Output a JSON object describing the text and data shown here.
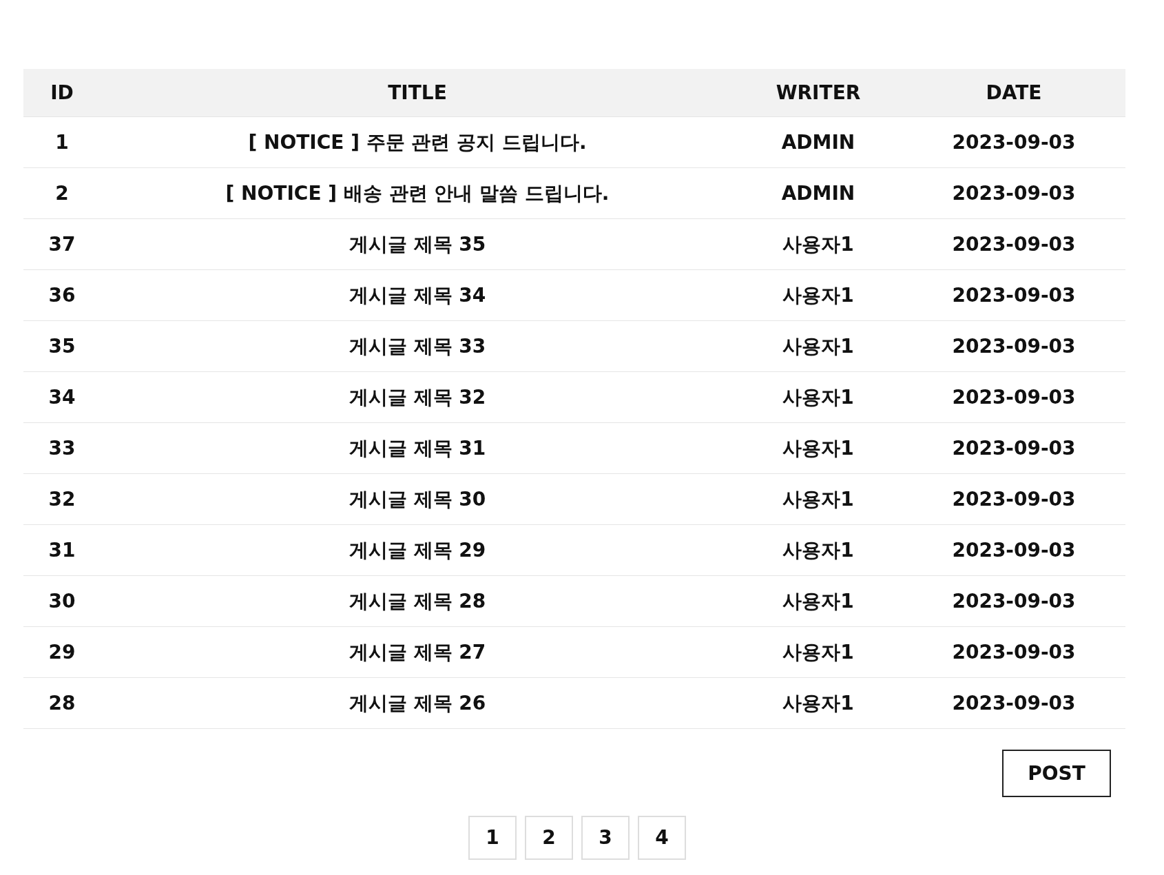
{
  "table": {
    "columns": [
      "ID",
      "TITLE",
      "WRITER",
      "DATE"
    ],
    "rows": [
      {
        "id": "1",
        "title": "[ NOTICE ] 주문 관련 공지 드립니다.",
        "writer": "ADMIN",
        "date": "2023-09-03"
      },
      {
        "id": "2",
        "title": "[ NOTICE ] 배송 관련 안내 말씀 드립니다.",
        "writer": "ADMIN",
        "date": "2023-09-03"
      },
      {
        "id": "37",
        "title": "게시글 제목 35",
        "writer": "사용자1",
        "date": "2023-09-03"
      },
      {
        "id": "36",
        "title": "게시글 제목 34",
        "writer": "사용자1",
        "date": "2023-09-03"
      },
      {
        "id": "35",
        "title": "게시글 제목 33",
        "writer": "사용자1",
        "date": "2023-09-03"
      },
      {
        "id": "34",
        "title": "게시글 제목 32",
        "writer": "사용자1",
        "date": "2023-09-03"
      },
      {
        "id": "33",
        "title": "게시글 제목 31",
        "writer": "사용자1",
        "date": "2023-09-03"
      },
      {
        "id": "32",
        "title": "게시글 제목 30",
        "writer": "사용자1",
        "date": "2023-09-03"
      },
      {
        "id": "31",
        "title": "게시글 제목 29",
        "writer": "사용자1",
        "date": "2023-09-03"
      },
      {
        "id": "30",
        "title": "게시글 제목 28",
        "writer": "사용자1",
        "date": "2023-09-03"
      },
      {
        "id": "29",
        "title": "게시글 제목 27",
        "writer": "사용자1",
        "date": "2023-09-03"
      },
      {
        "id": "28",
        "title": "게시글 제목 26",
        "writer": "사용자1",
        "date": "2023-09-03"
      }
    ]
  },
  "post_button": "POST",
  "pagination": [
    "1",
    "2",
    "3",
    "4"
  ]
}
